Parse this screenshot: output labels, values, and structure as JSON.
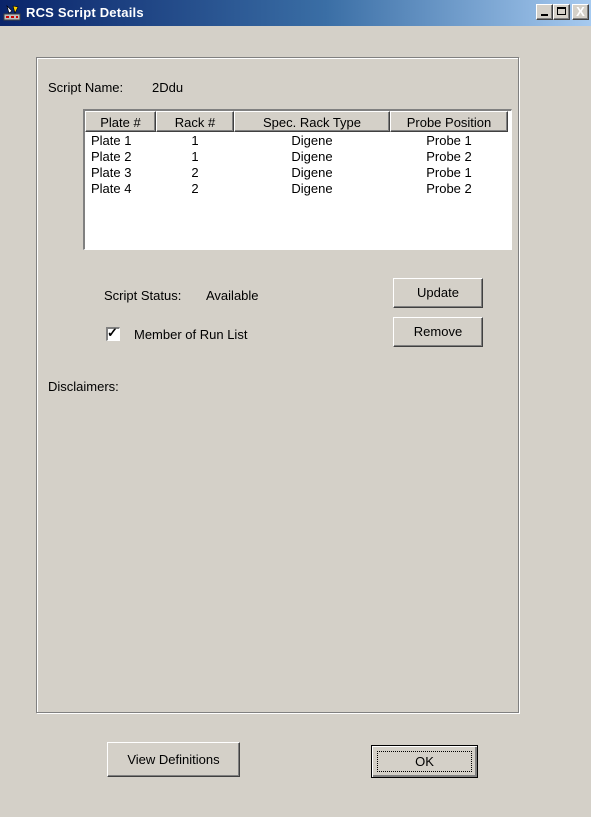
{
  "window": {
    "title": "RCS Script Details",
    "controls": {
      "minimize": "_",
      "maximize": "□",
      "close": "X"
    }
  },
  "script": {
    "name_label": "Script Name:",
    "name_value": "2Ddu"
  },
  "table": {
    "columns": [
      "Plate #",
      "Rack #",
      "Spec. Rack Type",
      "Probe Position"
    ],
    "rows": [
      [
        "Plate 1",
        "1",
        "Digene",
        "Probe 1"
      ],
      [
        "Plate 2",
        "1",
        "Digene",
        "Probe 2"
      ],
      [
        "Plate 3",
        "2",
        "Digene",
        "Probe 1"
      ],
      [
        "Plate 4",
        "2",
        "Digene",
        "Probe 2"
      ]
    ]
  },
  "status": {
    "label": "Script Status:",
    "value": "Available"
  },
  "run_list": {
    "label": "Member of Run List",
    "checked": true,
    "check_glyph": "✓"
  },
  "disclaimers": {
    "label": "Disclaimers:"
  },
  "buttons": {
    "update": "Update",
    "remove": "Remove",
    "view_definitions": "View Definitions",
    "ok": "OK"
  },
  "colors": {
    "titlebar_start": "#0a246a",
    "titlebar_end": "#a6caf0",
    "face": "#d4d0c8"
  }
}
